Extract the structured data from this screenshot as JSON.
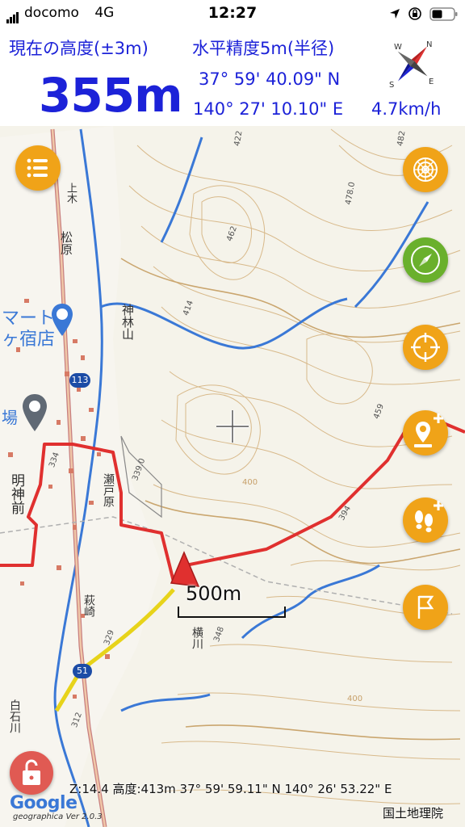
{
  "status_bar": {
    "carrier": "docomo",
    "network": "4G",
    "time": "12:27"
  },
  "hud": {
    "altitude_label": "現在の高度(±3m)",
    "altitude_value": "355m",
    "accuracy_label": "水平精度5m(半径)",
    "latitude": "37° 59' 40.09\" N",
    "longitude": "140° 27' 10.10\" E",
    "speed": "4.7km/h"
  },
  "map": {
    "poi_labels": {
      "mart": "マート",
      "shukuten": "ヶ宿店",
      "ba": "場",
      "myojin": "明神前",
      "road_113": "113",
      "road_51": "51",
      "kamibayashi": "神林山",
      "matsubara": "松原",
      "kakiyama": "上木",
      "shiroishi": "白石川",
      "yokogawa": "横川",
      "tsutsumi": "瀬戸原",
      "hagisaki": "萩崎",
      "elev_462": "462",
      "elev_478": "478.0",
      "elev_422": "422",
      "elev_482": "482",
      "elev_414": "414",
      "elev_459": "459",
      "elev_394": "394",
      "elev_400a": "400",
      "elev_400b": "400",
      "elev_339": "339.0",
      "elev_334": "334",
      "elev_329": "329",
      "elev_348": "348",
      "elev_312": "312"
    },
    "scale_label": "500m",
    "info_line": "Z:14.4 高度:413m  37° 59' 59.11\" N 140° 26' 53.22\" E",
    "google_logo": "Google",
    "version": "geographica Ver 2.0.3",
    "attribution": "国土地理院"
  },
  "buttons": {
    "menu": "menu-icon",
    "layers": "swirl-icon",
    "compass": "compass-icon",
    "locate": "target-icon",
    "add_point": "pin-plus-icon",
    "add_track": "footprints-plus-icon",
    "flag": "flag-icon",
    "lock": "lock-icon"
  },
  "colors": {
    "hud_text": "#1c22d8",
    "fab": "#f0a318",
    "fab_green": "#6ab02c",
    "track": "#e0302f",
    "lock": "#e05a53"
  }
}
